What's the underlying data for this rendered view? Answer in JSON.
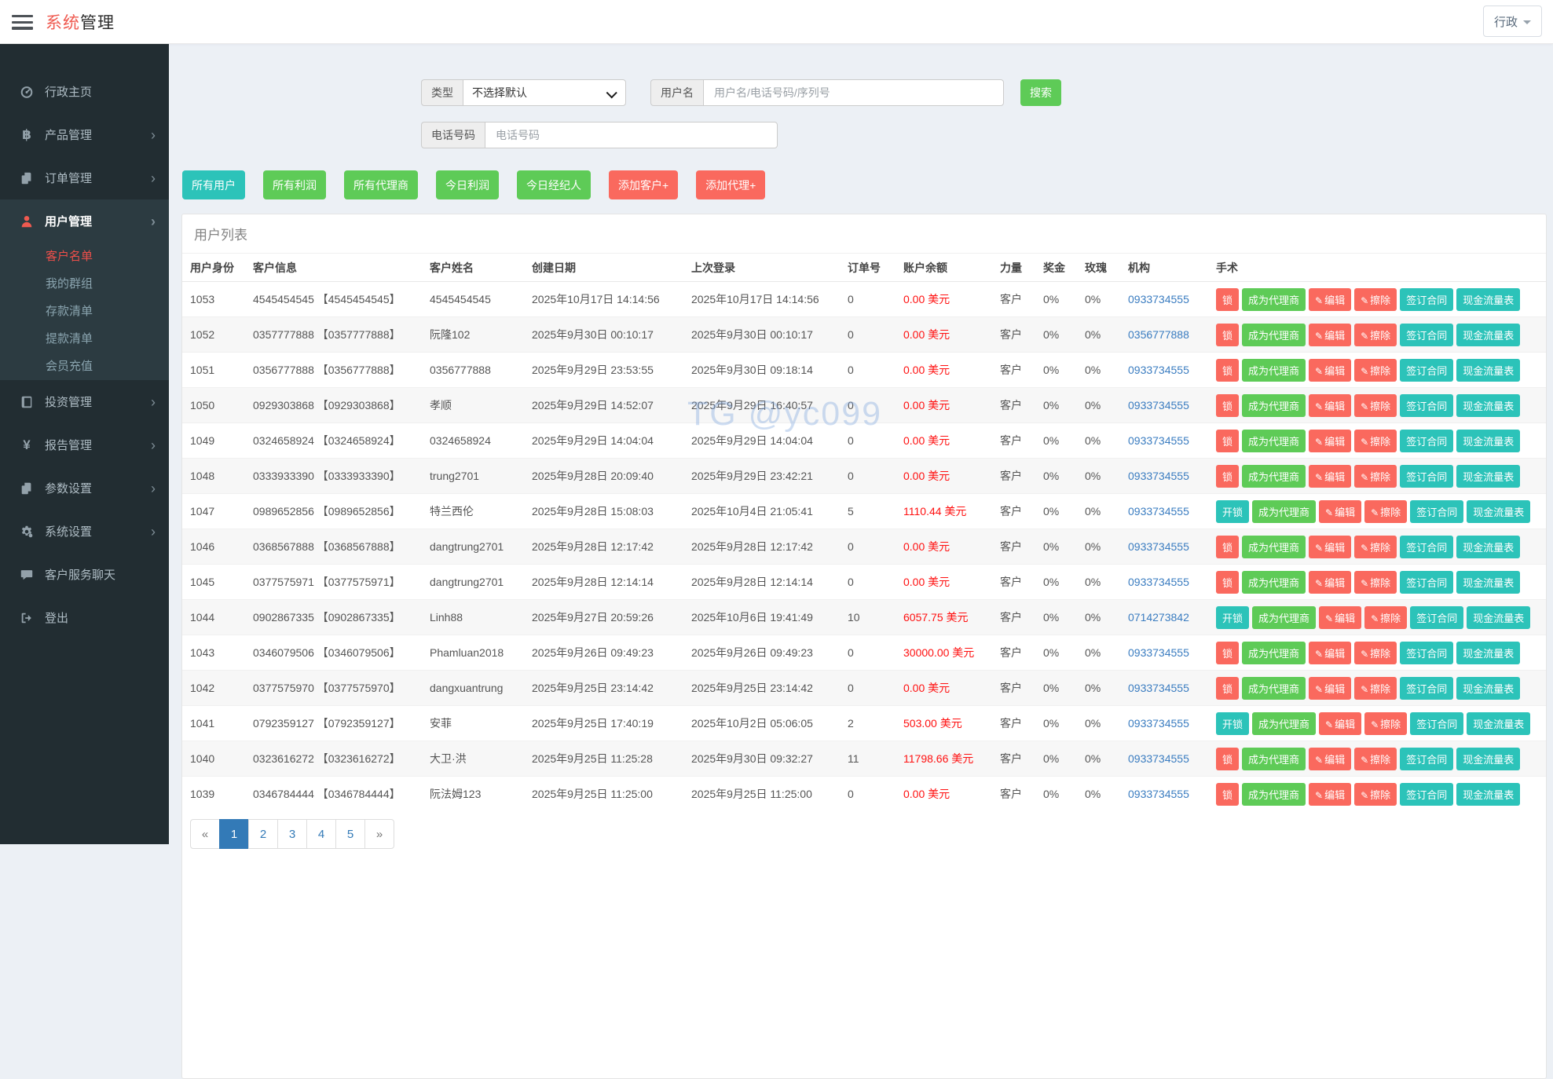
{
  "header": {
    "title_accent": "系统",
    "title_rest": "管理",
    "user_menu": "行政"
  },
  "sidebar": {
    "items": [
      {
        "label": "行政主页"
      },
      {
        "label": "产品管理"
      },
      {
        "label": "订单管理"
      },
      {
        "label": "用户管理",
        "active": true,
        "children": [
          "客户名单",
          "我的群组",
          "存款清单",
          "提款清单",
          "会员充值"
        ],
        "active_child": "客户名单"
      },
      {
        "label": "投资管理"
      },
      {
        "label": "报告管理"
      },
      {
        "label": "参数设置"
      },
      {
        "label": "系统设置"
      },
      {
        "label": "客户服务聊天"
      },
      {
        "label": "登出"
      }
    ]
  },
  "filters": {
    "type_label": "类型",
    "type_value": "不选择默认",
    "username_label": "用户名",
    "username_placeholder": "用户名/电话号码/序列号",
    "search_button": "搜索",
    "phone_label": "电话号码",
    "phone_placeholder": "电话号码"
  },
  "actions": [
    {
      "label": "所有用户",
      "color": "teal"
    },
    {
      "label": "所有利润",
      "color": "green"
    },
    {
      "label": "所有代理商",
      "color": "green"
    },
    {
      "label": "今日利润",
      "color": "green"
    },
    {
      "label": "今日经纪人",
      "color": "green"
    },
    {
      "label": "添加客户+",
      "color": "red"
    },
    {
      "label": "添加代理+",
      "color": "red"
    }
  ],
  "panel": {
    "title": "用户列表"
  },
  "table": {
    "columns": [
      "用户身份",
      "客户信息",
      "客户姓名",
      "创建日期",
      "上次登录",
      "订单号",
      "账户余额",
      "力量",
      "奖金",
      "玫瑰",
      "机构",
      "手术"
    ],
    "currency_suffix": "美元",
    "rows": [
      {
        "id": "1053",
        "info": "4545454545 【4545454545】",
        "name": "4545454545",
        "created": "2025年10月17日 14:14:56",
        "last_login": "2025年10月17日 14:14:56",
        "orders": "0",
        "balance": "0.00",
        "role": "客户",
        "bonus": "0%",
        "rose": "0%",
        "org": "0933734555",
        "locked": true
      },
      {
        "id": "1052",
        "info": "0357777888 【0357777888】",
        "name": "阮隆102",
        "created": "2025年9月30日 00:10:17",
        "last_login": "2025年9月30日 00:10:17",
        "orders": "0",
        "balance": "0.00",
        "role": "客户",
        "bonus": "0%",
        "rose": "0%",
        "org": "0356777888",
        "locked": true
      },
      {
        "id": "1051",
        "info": "0356777888 【0356777888】",
        "name": "0356777888",
        "created": "2025年9月29日 23:53:55",
        "last_login": "2025年9月30日 09:18:14",
        "orders": "0",
        "balance": "0.00",
        "role": "客户",
        "bonus": "0%",
        "rose": "0%",
        "org": "0933734555",
        "locked": true
      },
      {
        "id": "1050",
        "info": "0929303868 【0929303868】",
        "name": "孝顺",
        "created": "2025年9月29日 14:52:07",
        "last_login": "2025年9月29日 16:40:57",
        "orders": "0",
        "balance": "0.00",
        "role": "客户",
        "bonus": "0%",
        "rose": "0%",
        "org": "0933734555",
        "locked": true
      },
      {
        "id": "1049",
        "info": "0324658924 【0324658924】",
        "name": "0324658924",
        "created": "2025年9月29日 14:04:04",
        "last_login": "2025年9月29日 14:04:04",
        "orders": "0",
        "balance": "0.00",
        "role": "客户",
        "bonus": "0%",
        "rose": "0%",
        "org": "0933734555",
        "locked": true
      },
      {
        "id": "1048",
        "info": "0333933390 【0333933390】",
        "name": "trung2701",
        "created": "2025年9月28日 20:09:40",
        "last_login": "2025年9月29日 23:42:21",
        "orders": "0",
        "balance": "0.00",
        "role": "客户",
        "bonus": "0%",
        "rose": "0%",
        "org": "0933734555",
        "locked": true
      },
      {
        "id": "1047",
        "info": "0989652856 【0989652856】",
        "name": "特兰西伦",
        "created": "2025年9月28日 15:08:03",
        "last_login": "2025年10月4日 21:05:41",
        "orders": "5",
        "balance": "1110.44",
        "role": "客户",
        "bonus": "0%",
        "rose": "0%",
        "org": "0933734555",
        "locked": false
      },
      {
        "id": "1046",
        "info": "0368567888 【0368567888】",
        "name": "dangtrung2701",
        "created": "2025年9月28日 12:17:42",
        "last_login": "2025年9月28日 12:17:42",
        "orders": "0",
        "balance": "0.00",
        "role": "客户",
        "bonus": "0%",
        "rose": "0%",
        "org": "0933734555",
        "locked": true
      },
      {
        "id": "1045",
        "info": "0377575971 【0377575971】",
        "name": "dangtrung2701",
        "created": "2025年9月28日 12:14:14",
        "last_login": "2025年9月28日 12:14:14",
        "orders": "0",
        "balance": "0.00",
        "role": "客户",
        "bonus": "0%",
        "rose": "0%",
        "org": "0933734555",
        "locked": true
      },
      {
        "id": "1044",
        "info": "0902867335 【0902867335】",
        "name": "Linh88",
        "created": "2025年9月27日 20:59:26",
        "last_login": "2025年10月6日 19:41:49",
        "orders": "10",
        "balance": "6057.75",
        "role": "客户",
        "bonus": "0%",
        "rose": "0%",
        "org": "0714273842",
        "locked": false
      },
      {
        "id": "1043",
        "info": "0346079506 【0346079506】",
        "name": "Phamluan2018",
        "created": "2025年9月26日 09:49:23",
        "last_login": "2025年9月26日 09:49:23",
        "orders": "0",
        "balance": "30000.00",
        "role": "客户",
        "bonus": "0%",
        "rose": "0%",
        "org": "0933734555",
        "locked": true
      },
      {
        "id": "1042",
        "info": "0377575970 【0377575970】",
        "name": "dangxuantrung",
        "created": "2025年9月25日 23:14:42",
        "last_login": "2025年9月25日 23:14:42",
        "orders": "0",
        "balance": "0.00",
        "role": "客户",
        "bonus": "0%",
        "rose": "0%",
        "org": "0933734555",
        "locked": true
      },
      {
        "id": "1041",
        "info": "0792359127 【0792359127】",
        "name": "安菲",
        "created": "2025年9月25日 17:40:19",
        "last_login": "2025年10月2日 05:06:05",
        "orders": "2",
        "balance": "503.00",
        "role": "客户",
        "bonus": "0%",
        "rose": "0%",
        "org": "0933734555",
        "locked": false
      },
      {
        "id": "1040",
        "info": "0323616272 【0323616272】",
        "name": "大卫·洪",
        "created": "2025年9月25日 11:25:28",
        "last_login": "2025年9月30日 09:32:27",
        "orders": "11",
        "balance": "11798.66",
        "role": "客户",
        "bonus": "0%",
        "rose": "0%",
        "org": "0933734555",
        "locked": true
      },
      {
        "id": "1039",
        "info": "0346784444 【0346784444】",
        "name": "阮法姆123",
        "created": "2025年9月25日 11:25:00",
        "last_login": "2025年9月25日 11:25:00",
        "orders": "0",
        "balance": "0.00",
        "role": "客户",
        "bonus": "0%",
        "rose": "0%",
        "org": "0933734555",
        "locked": true
      }
    ]
  },
  "row_buttons": {
    "lock": "锁",
    "unlock": "开锁",
    "become_agent": "成为代理商",
    "edit": "编辑",
    "erase": "擦除",
    "sign_contract": "签订合同",
    "cash_flow": "现金流量表",
    "pencil": "✎"
  },
  "pagination": {
    "items": [
      "«",
      "1",
      "2",
      "3",
      "4",
      "5",
      "»"
    ],
    "active": "1"
  },
  "watermark": "TG @yc099",
  "colors": {
    "accent": "#ef5a50",
    "green": "#5ecb57",
    "teal": "#2cc3b9",
    "coral": "#fa695e",
    "link-blue": "#3a7cc0",
    "balance-red": "#ff1010",
    "page-blue": "#337ab7"
  }
}
